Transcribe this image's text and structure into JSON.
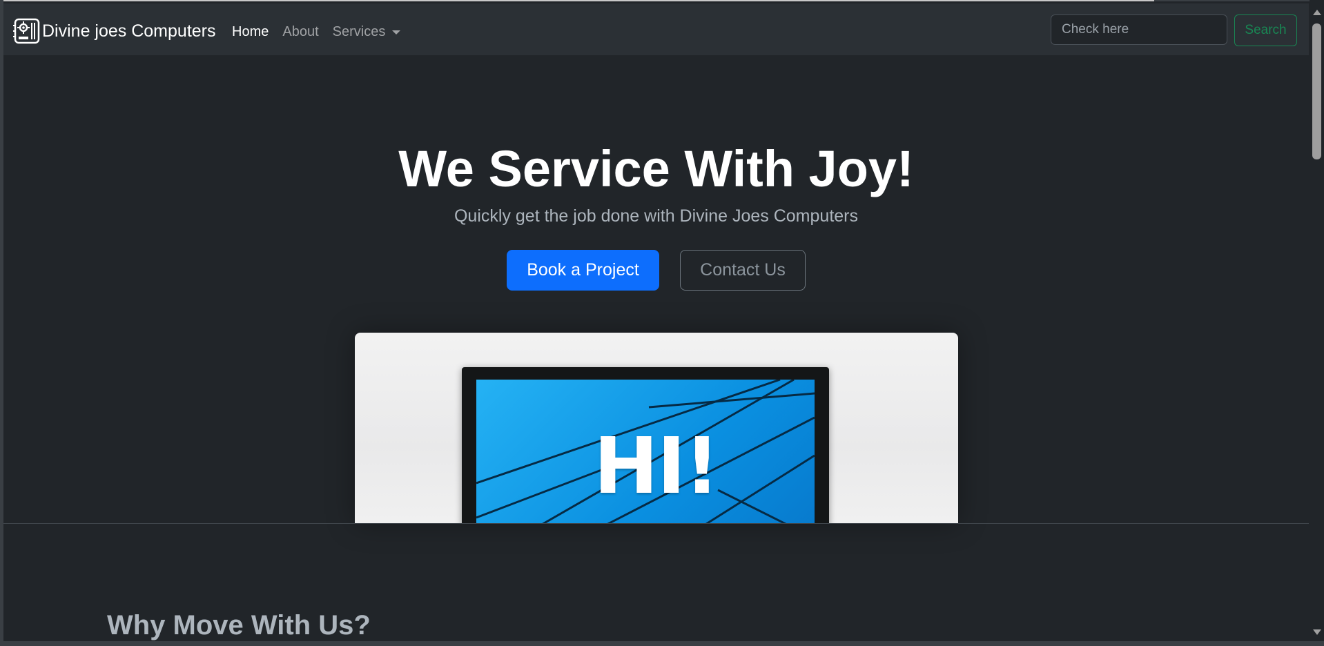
{
  "navbar": {
    "brand_text": "Divine joes Computers",
    "brand_icon": "motherboard-icon",
    "links": [
      {
        "label": "Home",
        "active": true
      },
      {
        "label": "About",
        "active": false
      },
      {
        "label": "Services",
        "active": false,
        "dropdown": true
      }
    ],
    "search": {
      "placeholder": "Check here",
      "value": "",
      "button_label": "Search"
    }
  },
  "hero": {
    "title": "We Service With Joy!",
    "subtitle": "Quickly get the job done with Divine Joes Computers",
    "primary_button": "Book a Project",
    "secondary_button": "Contact Us",
    "image_text": "HI!"
  },
  "section": {
    "heading": "Why Move With Us?"
  },
  "colors": {
    "background": "#212529",
    "navbar": "#2b3035",
    "primary": "#0d6efd",
    "success": "#198754",
    "muted": "#adb5bd",
    "screen_blue": "#0a8fe0"
  }
}
